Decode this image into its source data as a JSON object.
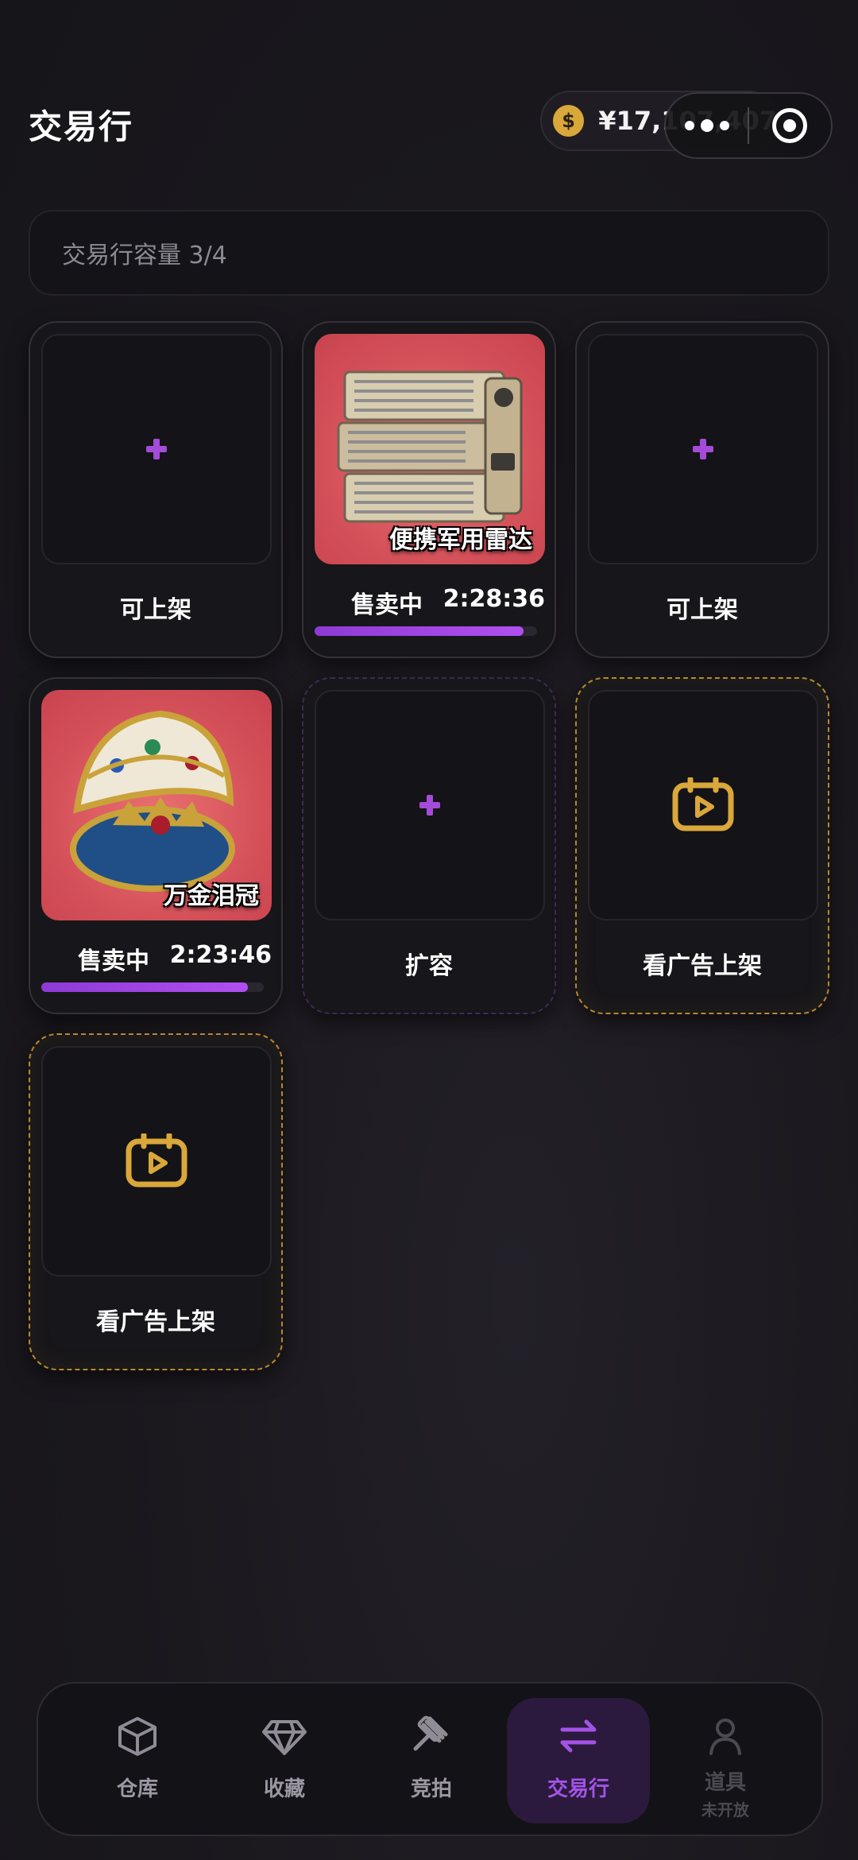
{
  "header": {
    "title": "交易行",
    "balance": "¥17,107,407",
    "coin_symbol": "$"
  },
  "capacity": {
    "label": "交易行容量 3/4"
  },
  "slots": [
    {
      "type": "empty",
      "label": "可上架"
    },
    {
      "type": "item",
      "item_name": "便携军用雷达",
      "status": "售卖中",
      "timer": "2:28:36",
      "progress": 0.94
    },
    {
      "type": "empty",
      "label": "可上架"
    },
    {
      "type": "item",
      "item_name": "万金泪冠",
      "status": "售卖中",
      "timer": "2:23:46",
      "progress": 0.93
    },
    {
      "type": "expand",
      "label": "扩容"
    },
    {
      "type": "ad",
      "label": "看广告上架"
    },
    {
      "type": "ad",
      "label": "看广告上架"
    }
  ],
  "tabs": [
    {
      "label": "仓库",
      "icon": "box-icon"
    },
    {
      "label": "收藏",
      "icon": "diamond-icon"
    },
    {
      "label": "竞拍",
      "icon": "gavel-icon"
    },
    {
      "label": "交易行",
      "icon": "swap-icon",
      "active": true
    },
    {
      "label": "道具",
      "sublabel": "未开放",
      "icon": "user-icon",
      "disabled": true
    }
  ],
  "colors": {
    "accent_purple": "#a54bd9",
    "ad_gold": "#d9a73a",
    "item_background": "#d5515a"
  }
}
